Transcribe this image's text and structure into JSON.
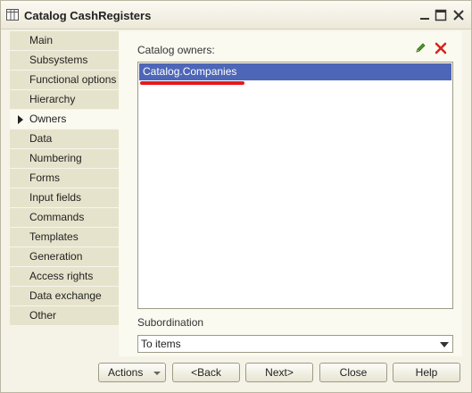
{
  "window": {
    "title": "Catalog CashRegisters"
  },
  "sidebar": {
    "items": [
      {
        "label": "Main"
      },
      {
        "label": "Subsystems"
      },
      {
        "label": "Functional options"
      },
      {
        "label": "Hierarchy"
      },
      {
        "label": "Owners",
        "active": true
      },
      {
        "label": "Data"
      },
      {
        "label": "Numbering"
      },
      {
        "label": "Forms"
      },
      {
        "label": "Input fields"
      },
      {
        "label": "Commands"
      },
      {
        "label": "Templates"
      },
      {
        "label": "Generation"
      },
      {
        "label": "Access rights"
      },
      {
        "label": "Data exchange"
      },
      {
        "label": "Other"
      }
    ]
  },
  "owners": {
    "label": "Catalog owners:",
    "items": [
      "Catalog.Companies"
    ],
    "edit_icon": "pencil-icon",
    "delete_icon": "red-x-icon"
  },
  "subordination": {
    "label": "Subordination",
    "value": "To items"
  },
  "footer": {
    "actions": "Actions",
    "back": "<Back",
    "next": "Next>",
    "close": "Close",
    "help": "Help"
  },
  "colors": {
    "selection": "#4d66b8",
    "annotation_underline": "#e8181b",
    "delete_icon": "#d9241f",
    "edit_icon": "#4a9a2a"
  }
}
